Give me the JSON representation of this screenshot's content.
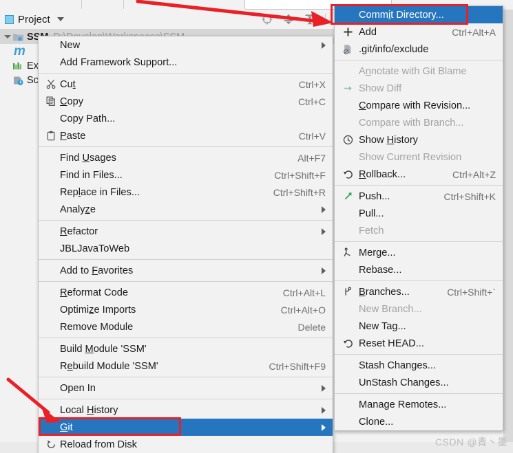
{
  "window": {
    "tool_window_title": "Project",
    "watermark": "CSDN @青丶墨"
  },
  "toolbar": {
    "icons": [
      {
        "name": "locate-icon",
        "glyph": "target"
      },
      {
        "name": "expand-all-icon",
        "glyph": "expand"
      },
      {
        "name": "collapse-all-icon",
        "glyph": "collapse"
      },
      {
        "name": "settings-gear-icon",
        "glyph": "gear"
      },
      {
        "name": "hide-icon",
        "glyph": "minus"
      }
    ]
  },
  "project_tree": [
    {
      "name": "SSM",
      "path": "D:\\Develop\\Workspaces\\SSM",
      "icon": "module-folder-icon",
      "expanded": true
    },
    {
      "name": "m",
      "path": "",
      "icon": "maven-icon",
      "expanded": false
    },
    {
      "name": "External Libraries",
      "path": "",
      "icon": "libraries-icon",
      "expanded": false
    },
    {
      "name": "Scratches and Consoles",
      "path": "",
      "icon": "scratches-icon",
      "expanded": false
    }
  ],
  "context_menu": {
    "name": "project-context-menu",
    "items": [
      {
        "label": "New",
        "accel": "",
        "icon": "",
        "submenu": true,
        "disabled": false,
        "mnemonic": ""
      },
      {
        "label": "Add Framework Support...",
        "accel": "",
        "icon": "",
        "submenu": false,
        "disabled": false
      },
      {
        "separator": true
      },
      {
        "label": "Cut",
        "accel": "Ctrl+X",
        "icon": "scissors-icon",
        "submenu": false,
        "disabled": false
      },
      {
        "label": "Copy",
        "accel": "Ctrl+C",
        "icon": "copy-icon",
        "submenu": false,
        "disabled": false
      },
      {
        "label": "Copy Path...",
        "accel": "",
        "icon": "",
        "submenu": false,
        "disabled": false
      },
      {
        "label": "Paste",
        "accel": "Ctrl+V",
        "icon": "clipboard-icon",
        "submenu": false,
        "disabled": false
      },
      {
        "separator": true
      },
      {
        "label": "Find Usages",
        "accel": "Alt+F7",
        "icon": "",
        "submenu": false,
        "disabled": false
      },
      {
        "label": "Find in Files...",
        "accel": "Ctrl+Shift+F",
        "icon": "",
        "submenu": false,
        "disabled": false
      },
      {
        "label": "Replace in Files...",
        "accel": "Ctrl+Shift+R",
        "icon": "",
        "submenu": false,
        "disabled": false
      },
      {
        "label": "Analyze",
        "accel": "",
        "icon": "",
        "submenu": true,
        "disabled": false
      },
      {
        "separator": true
      },
      {
        "label": "Refactor",
        "accel": "",
        "icon": "",
        "submenu": true,
        "disabled": false
      },
      {
        "label": "JBLJavaToWeb",
        "accel": "",
        "icon": "",
        "submenu": false,
        "disabled": false
      },
      {
        "separator": true
      },
      {
        "label": "Add to Favorites",
        "accel": "",
        "icon": "",
        "submenu": true,
        "disabled": false
      },
      {
        "separator": true
      },
      {
        "label": "Reformat Code",
        "accel": "Ctrl+Alt+L",
        "icon": "",
        "submenu": false,
        "disabled": false
      },
      {
        "label": "Optimize Imports",
        "accel": "Ctrl+Alt+O",
        "icon": "",
        "submenu": false,
        "disabled": false
      },
      {
        "label": "Remove Module",
        "accel": "Delete",
        "icon": "",
        "submenu": false,
        "disabled": false
      },
      {
        "separator": true
      },
      {
        "label": "Build Module 'SSM'",
        "accel": "",
        "icon": "",
        "submenu": false,
        "disabled": false
      },
      {
        "label": "Rebuild Module 'SSM'",
        "accel": "Ctrl+Shift+F9",
        "icon": "",
        "submenu": false,
        "disabled": false
      },
      {
        "separator": true
      },
      {
        "label": "Open In",
        "accel": "",
        "icon": "",
        "submenu": true,
        "disabled": false
      },
      {
        "separator": true
      },
      {
        "label": "Local History",
        "accel": "",
        "icon": "",
        "submenu": true,
        "disabled": false
      },
      {
        "label": "Git",
        "accel": "",
        "icon": "",
        "submenu": true,
        "disabled": false,
        "selected": true
      },
      {
        "label": "Reload from Disk",
        "accel": "",
        "icon": "refresh-icon",
        "submenu": false,
        "disabled": false
      }
    ]
  },
  "git_submenu": {
    "name": "git-submenu",
    "items": [
      {
        "label": "Commit Directory...",
        "accel": "",
        "icon": "",
        "submenu": false,
        "disabled": false,
        "selected": true
      },
      {
        "label": "Add",
        "accel": "Ctrl+Alt+A",
        "icon": "plus-icon",
        "submenu": false,
        "disabled": false
      },
      {
        "label": ".git/info/exclude",
        "accel": "",
        "icon": "exclude-file-icon",
        "submenu": false,
        "disabled": false
      },
      {
        "separator": true
      },
      {
        "label": "Annotate with Git Blame",
        "accel": "",
        "icon": "",
        "submenu": false,
        "disabled": true
      },
      {
        "label": "Show Diff",
        "accel": "",
        "icon": "diff-icon",
        "submenu": false,
        "disabled": true
      },
      {
        "label": "Compare with Revision...",
        "accel": "",
        "icon": "",
        "submenu": false,
        "disabled": false
      },
      {
        "label": "Compare with Branch...",
        "accel": "",
        "icon": "",
        "submenu": false,
        "disabled": true
      },
      {
        "label": "Show History",
        "accel": "",
        "icon": "clock-icon",
        "submenu": false,
        "disabled": false
      },
      {
        "label": "Show Current Revision",
        "accel": "",
        "icon": "",
        "submenu": false,
        "disabled": true
      },
      {
        "label": "Rollback...",
        "accel": "Ctrl+Alt+Z",
        "icon": "rollback-icon",
        "submenu": false,
        "disabled": false
      },
      {
        "separator": true
      },
      {
        "label": "Push...",
        "accel": "Ctrl+Shift+K",
        "icon": "push-arrow-icon",
        "submenu": false,
        "disabled": false
      },
      {
        "label": "Pull...",
        "accel": "",
        "icon": "",
        "submenu": false,
        "disabled": false
      },
      {
        "label": "Fetch",
        "accel": "",
        "icon": "",
        "submenu": false,
        "disabled": true
      },
      {
        "separator": true
      },
      {
        "label": "Merge...",
        "accel": "",
        "icon": "merge-icon",
        "submenu": false,
        "disabled": false
      },
      {
        "label": "Rebase...",
        "accel": "",
        "icon": "",
        "submenu": false,
        "disabled": false
      },
      {
        "separator": true
      },
      {
        "label": "Branches...",
        "accel": "Ctrl+Shift+`",
        "icon": "branch-icon",
        "submenu": false,
        "disabled": false
      },
      {
        "label": "New Branch...",
        "accel": "",
        "icon": "",
        "submenu": false,
        "disabled": true
      },
      {
        "label": "New Tag...",
        "accel": "",
        "icon": "",
        "submenu": false,
        "disabled": false
      },
      {
        "label": "Reset HEAD...",
        "accel": "",
        "icon": "reset-icon",
        "submenu": false,
        "disabled": false
      },
      {
        "separator": true
      },
      {
        "label": "Stash Changes...",
        "accel": "",
        "icon": "",
        "submenu": false,
        "disabled": false
      },
      {
        "label": "UnStash Changes...",
        "accel": "",
        "icon": "",
        "submenu": false,
        "disabled": false
      },
      {
        "separator": true
      },
      {
        "label": "Manage Remotes...",
        "accel": "",
        "icon": "",
        "submenu": false,
        "disabled": false
      },
      {
        "label": "Clone...",
        "accel": "",
        "icon": "",
        "submenu": false,
        "disabled": false
      }
    ]
  },
  "annotations": {
    "accent_red": "#ea2027",
    "selection_blue": "#2675bf",
    "highlight_boxes": [
      "commit-directory-highlight",
      "git-menu-item-highlight"
    ]
  }
}
